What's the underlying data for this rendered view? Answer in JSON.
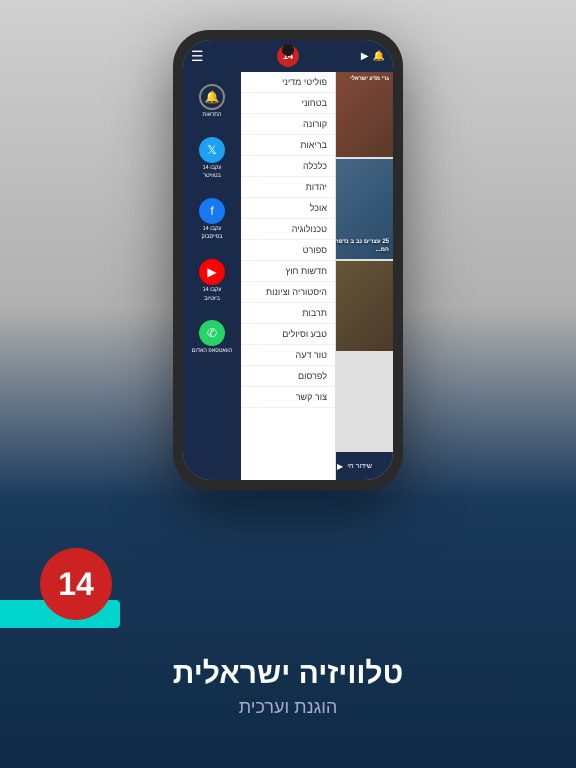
{
  "app": {
    "logo_number": "14",
    "title": "טלוויזיה ישראלית",
    "subtitle": "הוגנת וערכית"
  },
  "phone": {
    "camera_label": "camera"
  },
  "header": {
    "hamburger": "☰",
    "logo": "14",
    "icon1": "▶",
    "icon2": "🔔"
  },
  "notifications_panel": {
    "bell_label": "התראות",
    "twitter_line1": "עקבו 14",
    "twitter_line2": "בטוויטר",
    "facebook_line1": "עקבו 14",
    "facebook_line2": "בפייסבוק",
    "youtube_line1": "עקבו 14",
    "youtube_line2": "ביוטיוב",
    "whatsapp_label": "הוואטסאפ האדום"
  },
  "menu": {
    "items": [
      "פוליטי מדיני",
      "בטחוני",
      "קורונה",
      "בריאות",
      "כלכלה",
      "יהדות",
      "אוכל",
      "טכנולוגיה",
      "ספורט",
      "חדשות חוץ",
      "היסטוריה וציונות",
      "תרבות",
      "טבע וסיולים",
      "טור דעה",
      "לפרסום",
      "צור קשר"
    ]
  },
  "news": {
    "card1_text": "גרי מדע ישראלי",
    "card2_text": "25 עצרים נב ב נדפח ע\"י המ...",
    "card3_text": ""
  },
  "bottom_bar": {
    "icon": "▶",
    "label": "שידור חי"
  },
  "colors": {
    "header_bg": "#1a2a4a",
    "logo_red": "#cc2222",
    "teal": "#00d4cc",
    "sidebar_bg": "#ffffff",
    "dark_navy": "#0e2a45"
  }
}
